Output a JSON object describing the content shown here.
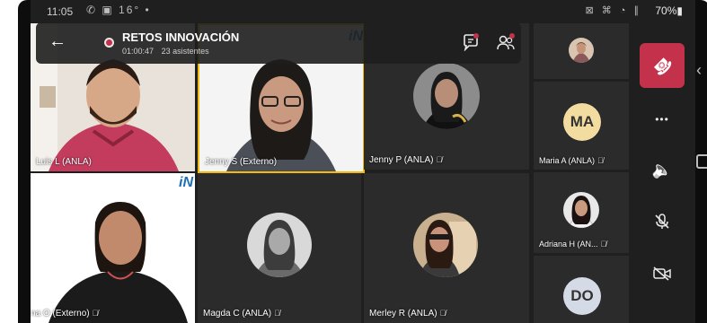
{
  "status_bar": {
    "time": "11:05",
    "left_icons": "✆ ▣ 16° •",
    "right_icons": "⊠ ⌘ ◔ ∥",
    "battery": "70%▮"
  },
  "meeting": {
    "title": "RETOS INNOVACIÓN",
    "duration": "01:00:47",
    "attendees": "23 asistentes",
    "logo_i": "i",
    "logo_n": "N"
  },
  "participants": {
    "luis": {
      "name": "Luis L (ANLA)"
    },
    "jenny_s": {
      "name": "Jenny S (Externo)"
    },
    "jenny_p": {
      "name": "Jenny P (ANLA)"
    },
    "maria": {
      "name": "Maria A (ANLA)",
      "initials": "MA"
    },
    "adriana": {
      "name": "Adriana H (AN..."
    },
    "ana": {
      "name": "na O (Externo)"
    },
    "magda": {
      "name": "Magda C (ANLA)"
    },
    "merley": {
      "name": "Merley R (ANLA)"
    },
    "do_user": {
      "initials": "DO"
    }
  },
  "colors": {
    "hangup": "#c4314b",
    "active_speaker": "#f2b90f",
    "notification": "#c4314b",
    "initials_ma_bg": "#f3dca0",
    "initials_do_bg": "#d5dbe6"
  },
  "controls": {
    "hangup_icon": "☎",
    "more_icon": "•••",
    "speaker_icon": "🔈",
    "mic_icon": "🎙",
    "camera_icon": "📹"
  }
}
